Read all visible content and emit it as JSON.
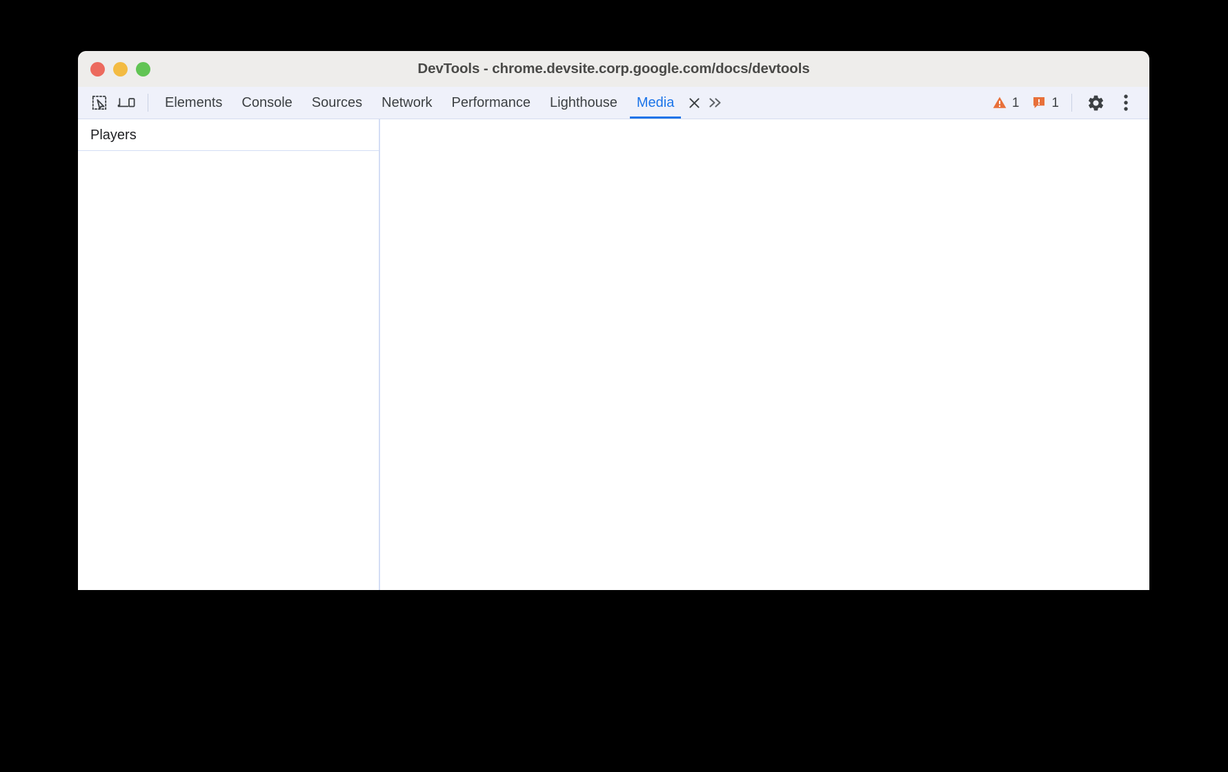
{
  "window": {
    "title": "DevTools - chrome.devsite.corp.google.com/docs/devtools",
    "traffic_lights": [
      {
        "name": "close",
        "color": "#ec6a5e"
      },
      {
        "name": "minimize",
        "color": "#f3bb42"
      },
      {
        "name": "maximize",
        "color": "#61c454"
      }
    ]
  },
  "toolbar": {
    "inspect_icon": "inspect-element-icon",
    "device_icon": "device-toolbar-icon",
    "settings_icon": "gear-icon",
    "more_icon": "more-vertical-icon",
    "more_tabs_icon": "chevron-double-right-icon",
    "close_tab_icon": "close-icon"
  },
  "tabs": [
    {
      "label": "Elements",
      "active": false
    },
    {
      "label": "Console",
      "active": false
    },
    {
      "label": "Sources",
      "active": false
    },
    {
      "label": "Network",
      "active": false
    },
    {
      "label": "Performance",
      "active": false
    },
    {
      "label": "Lighthouse",
      "active": false
    },
    {
      "label": "Media",
      "active": true
    }
  ],
  "status": {
    "warning_icon": "warning-triangle-icon",
    "warning_count": "1",
    "issue_icon": "issue-exclamation-icon",
    "issue_count": "1",
    "warning_color": "#e8703a",
    "issue_color": "#e8703a"
  },
  "sidebar": {
    "title": "Players",
    "items": []
  },
  "main": {
    "content": ""
  },
  "colors": {
    "accent": "#1a73e8",
    "titlebar_bg": "#eeedeb",
    "tabbar_bg": "#eff1fa",
    "divider": "#d3ddf5",
    "text": "#3c4043"
  }
}
